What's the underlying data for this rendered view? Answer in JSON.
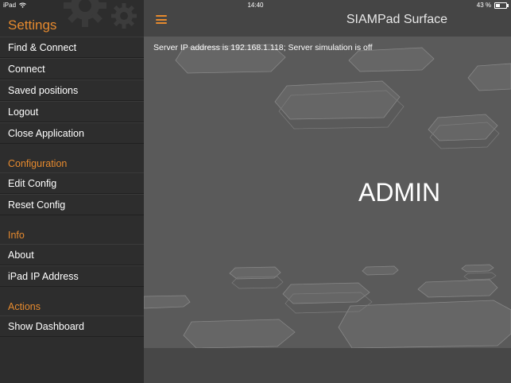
{
  "status_bar": {
    "device": "iPad",
    "time": "14:40",
    "battery": "43 %",
    "battery_level": 0.43
  },
  "sidebar": {
    "title": "Settings",
    "items": [
      {
        "label": "Find & Connect"
      },
      {
        "label": "Connect"
      },
      {
        "label": "Saved positions"
      },
      {
        "label": "Logout"
      },
      {
        "label": "Close Application"
      }
    ],
    "sections": [
      {
        "title": "Configuration",
        "items": [
          {
            "label": "Edit Config"
          },
          {
            "label": "Reset Config"
          }
        ]
      },
      {
        "title": "Info",
        "items": [
          {
            "label": "About"
          },
          {
            "label": "iPad IP Address"
          }
        ]
      },
      {
        "title": "Actions",
        "items": [
          {
            "label": "Show Dashboard"
          }
        ]
      }
    ]
  },
  "main": {
    "title": "SIAMPad Surface",
    "server_status": "Server IP address is 192.168.1.118; Server simulation is off",
    "role": "ADMIN"
  },
  "colors": {
    "accent": "#e68a2e",
    "sidebar_bg": "#2d2d2d",
    "main_bg": "#5a5a5a"
  }
}
